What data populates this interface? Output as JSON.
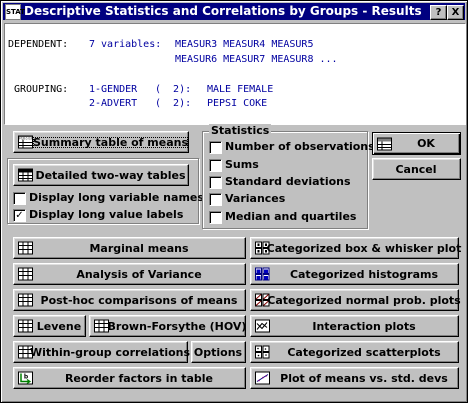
{
  "window": {
    "title": "Descriptive Statistics and Correlations by Groups - Results",
    "icon_text": "STAT",
    "help_label": "?",
    "close_label": "X"
  },
  "info": {
    "dependent_label": "DEPENDENT:",
    "dependent_count": "7 variables:",
    "dependent_line1": "MEASUR3 MEASUR4 MEASUR5",
    "dependent_line2": "MEASUR6 MEASUR7 MEASUR8 ...",
    "grouping_label": "GROUPING:",
    "group1_name": "1-GENDER",
    "group1_count": "(  2):",
    "group1_values": "MALE FEMALE",
    "group2_name": "2-ADVERT",
    "group2_count": "(  2):",
    "group2_values": "PEPSI COKE"
  },
  "left_panel": {
    "summary_button": "Summary table of means",
    "twoway_button": "Detailed two-way tables",
    "long_var_names": {
      "label": "Display long variable names",
      "checked": false
    },
    "long_value_labels": {
      "label": "Display long value labels",
      "checked": true
    }
  },
  "statistics": {
    "title": "Statistics",
    "items": [
      {
        "label": "Number of observations",
        "checked": false
      },
      {
        "label": "Sums",
        "checked": false
      },
      {
        "label": "Standard deviations",
        "checked": false
      },
      {
        "label": "Variances",
        "checked": false
      },
      {
        "label": "Median and quartiles",
        "checked": false
      }
    ]
  },
  "dialog_buttons": {
    "ok": "OK",
    "cancel": "Cancel"
  },
  "analysis_buttons": {
    "marginal_means": "Marginal means",
    "anova": "Analysis of Variance",
    "posthoc": "Post-hoc comparisons of means",
    "levene": "Levene",
    "brown_forsythe": "Brown-Forsythe (HOV)",
    "within_group": "Within-group correlations",
    "options": "Options",
    "reorder": "Reorder factors in table",
    "cat_box": "Categorized box & whisker plot",
    "cat_hist": "Categorized histograms",
    "cat_normal": "Categorized normal prob. plots",
    "interaction": "Interaction plots",
    "cat_scatter": "Categorized scatterplots",
    "means_vs_sd": "Plot of means vs. std. devs"
  },
  "colors": {
    "title_bar": "#000080",
    "face": "#c0c0c0",
    "text_blue": "#0000a0"
  }
}
